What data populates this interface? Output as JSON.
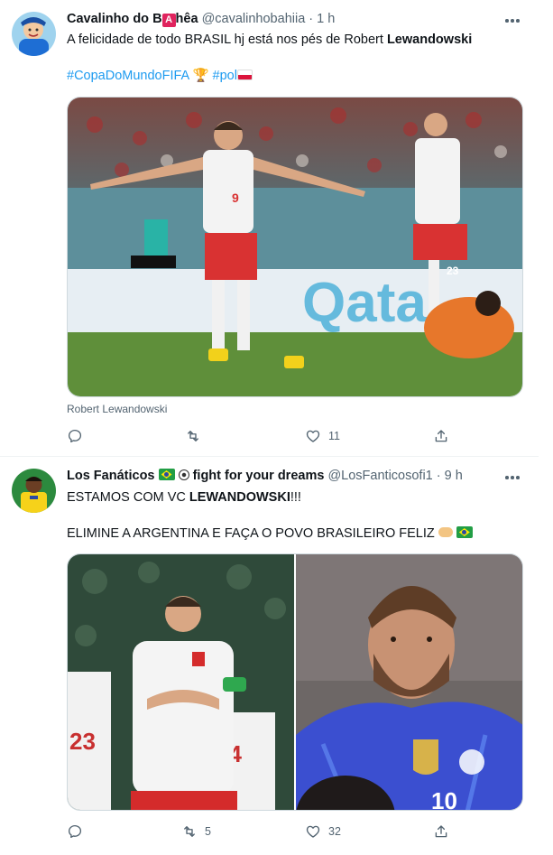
{
  "tweets": [
    {
      "author": {
        "name_prefix": "Cavalinho do B",
        "name_badge": "A",
        "name_suffix": "hêa",
        "handle": "@cavalinhobahiia",
        "separator": "·",
        "time": "1 h"
      },
      "text_normal": "A felicidade de todo BRASIL hj está nos pés de Robert ",
      "text_bold": "Lewandowski",
      "hashtag1": "#CopaDoMundoFIFA",
      "hashtag1_emoji": "🏆",
      "hashtag2": "#pol",
      "media_caption": "Robert Lewandowski",
      "media_icon": "trophy-icon",
      "actions": {
        "reply_count": "",
        "retweet_count": "",
        "like_count": "11"
      }
    },
    {
      "author": {
        "name": "Los Fanáticos",
        "name_suffix": "fight for your dreams",
        "handle": "@LosFanticosofi1",
        "separator": "·",
        "time": "9 h"
      },
      "line1_normal": "ESTAMOS COM VC ",
      "line1_bold": "LEWANDOWSKI",
      "line1_tail": "!!!",
      "line2": "ELIMINE A ARGENTINA E FAÇA O POVO BRASILEIRO FELIZ",
      "emoji_names": [
        "brazil-flag",
        "soccer-ball",
        "handshake",
        "brazil-flag"
      ],
      "actions": {
        "reply_count": "",
        "retweet_count": "5",
        "like_count": "32"
      }
    }
  ],
  "jersey_numbers": {
    "lewandowski": "9",
    "teammate_right": "23",
    "left_player": "23",
    "right_player": "24",
    "messi_back": "10"
  },
  "colors": {
    "accent": "#1d9bf0",
    "text": "#0f1419",
    "muted": "#536471",
    "border": "#eff3f4",
    "poland_red": "#dc143c",
    "argentina_blue": "#3b4fd0"
  }
}
